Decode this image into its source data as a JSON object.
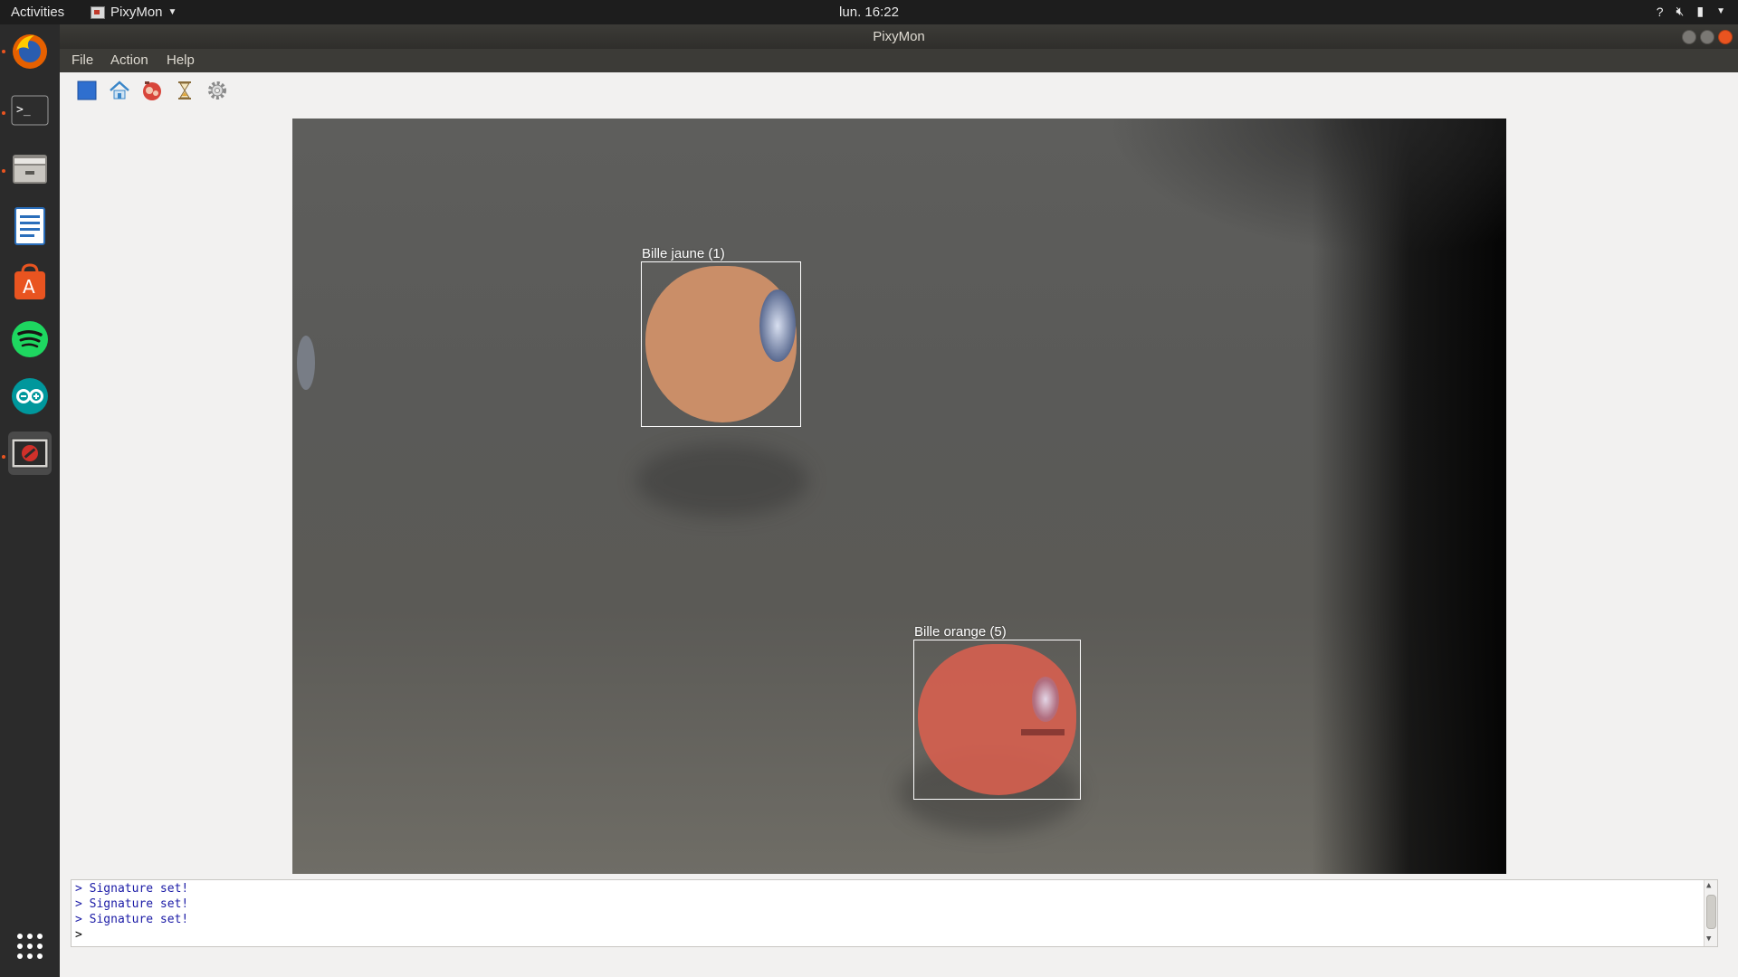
{
  "topbar": {
    "activities": "Activities",
    "app_menu": "PixyMon",
    "clock": "lun. 16:22",
    "tray_help": "?"
  },
  "window": {
    "title": "PixyMon"
  },
  "menubar": {
    "file": "File",
    "action": "Action",
    "help": "Help"
  },
  "toolbar": {
    "items": [
      "run-stop-icon",
      "home-icon",
      "raw-video-icon",
      "hourglass-icon",
      "settings-gear-icon"
    ]
  },
  "detections": [
    {
      "label": "Bille jaune (1)",
      "color": "#d9956a"
    },
    {
      "label": "Bille orange (5)",
      "color": "#d9604f"
    }
  ],
  "console": {
    "lines": [
      "> Signature set!",
      "> Signature set!",
      "> Signature set!"
    ],
    "prompt": ">"
  },
  "dock": {
    "apps": [
      "firefox-icon",
      "terminal-icon",
      "files-icon",
      "libreoffice-writer-icon",
      "software-center-icon",
      "spotify-icon",
      "arduino-icon",
      "pixymon-icon",
      "show-applications-icon"
    ]
  },
  "colors": {
    "accent": "#e95420",
    "console_text": "#1a1aa6"
  }
}
